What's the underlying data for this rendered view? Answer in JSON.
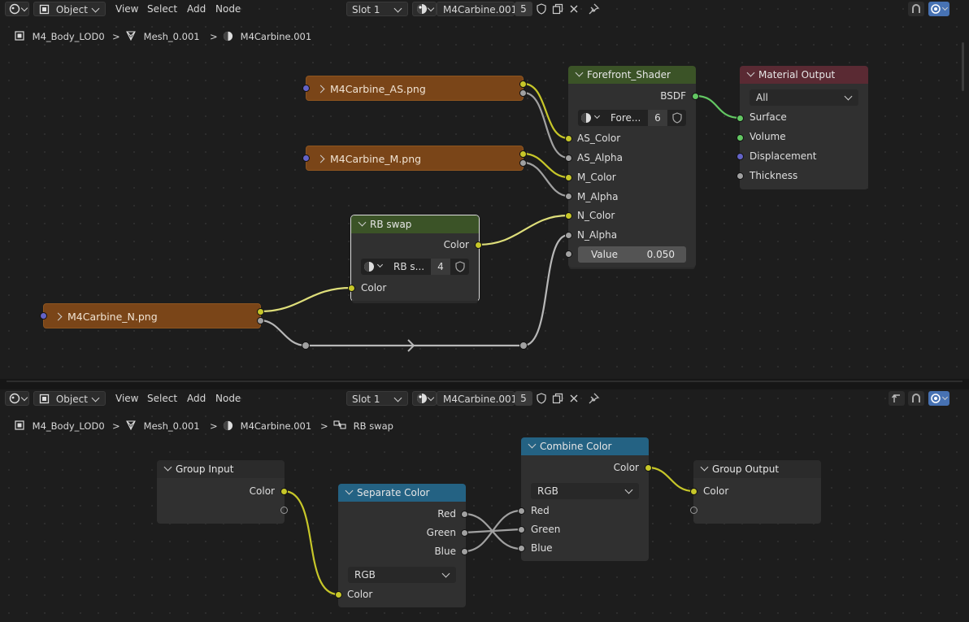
{
  "top": {
    "header": {
      "mode": "Object",
      "menus": [
        "View",
        "Select",
        "Add",
        "Node"
      ],
      "slot": "Slot 1",
      "material": "M4Carbine.001",
      "users": "5"
    },
    "breadcrumb": [
      "M4_Body_LOD0",
      "Mesh_0.001",
      "M4Carbine.001"
    ],
    "nodes": {
      "tex_as": "M4Carbine_AS.png",
      "tex_m": "M4Carbine_M.png",
      "tex_n": "M4Carbine_N.png",
      "rb_swap": {
        "title": "RB swap",
        "out": "Color",
        "group_name": "RB s...",
        "users": "4",
        "in": "Color"
      },
      "shader": {
        "title": "Forefront_Shader",
        "out": "BSDF",
        "group_name": "Fore...",
        "users": "6",
        "inputs": [
          "AS_Color",
          "AS_Alpha",
          "M_Color",
          "M_Alpha",
          "N_Color",
          "N_Alpha"
        ],
        "value_label": "Value",
        "value": "0.050"
      },
      "output": {
        "title": "Material Output",
        "target": "All",
        "inputs": [
          "Surface",
          "Volume",
          "Displacement",
          "Thickness"
        ]
      }
    }
  },
  "bottom": {
    "header": {
      "mode": "Object",
      "menus": [
        "View",
        "Select",
        "Add",
        "Node"
      ],
      "slot": "Slot 1",
      "material": "M4Carbine.001",
      "users": "5"
    },
    "breadcrumb": [
      "M4_Body_LOD0",
      "Mesh_0.001",
      "M4Carbine.001",
      "RB swap"
    ],
    "nodes": {
      "group_input": {
        "title": "Group Input",
        "out": "Color"
      },
      "separate": {
        "title": "Separate Color",
        "outs": [
          "Red",
          "Green",
          "Blue"
        ],
        "mode": "RGB",
        "in": "Color"
      },
      "combine": {
        "title": "Combine Color",
        "out": "Color",
        "mode": "RGB",
        "ins": [
          "Red",
          "Green",
          "Blue"
        ]
      },
      "group_output": {
        "title": "Group Output",
        "in": "Color"
      }
    }
  },
  "colors": {
    "accent": "#4772b3",
    "texture_node": "#7a4518",
    "group_header": "#3b5327",
    "output_header": "#5a2a33",
    "converter_header": "#246283",
    "socket_color": "#c7c729",
    "socket_float": "#a1a1a1",
    "socket_shader": "#63c763",
    "socket_vector": "#6363c7"
  }
}
